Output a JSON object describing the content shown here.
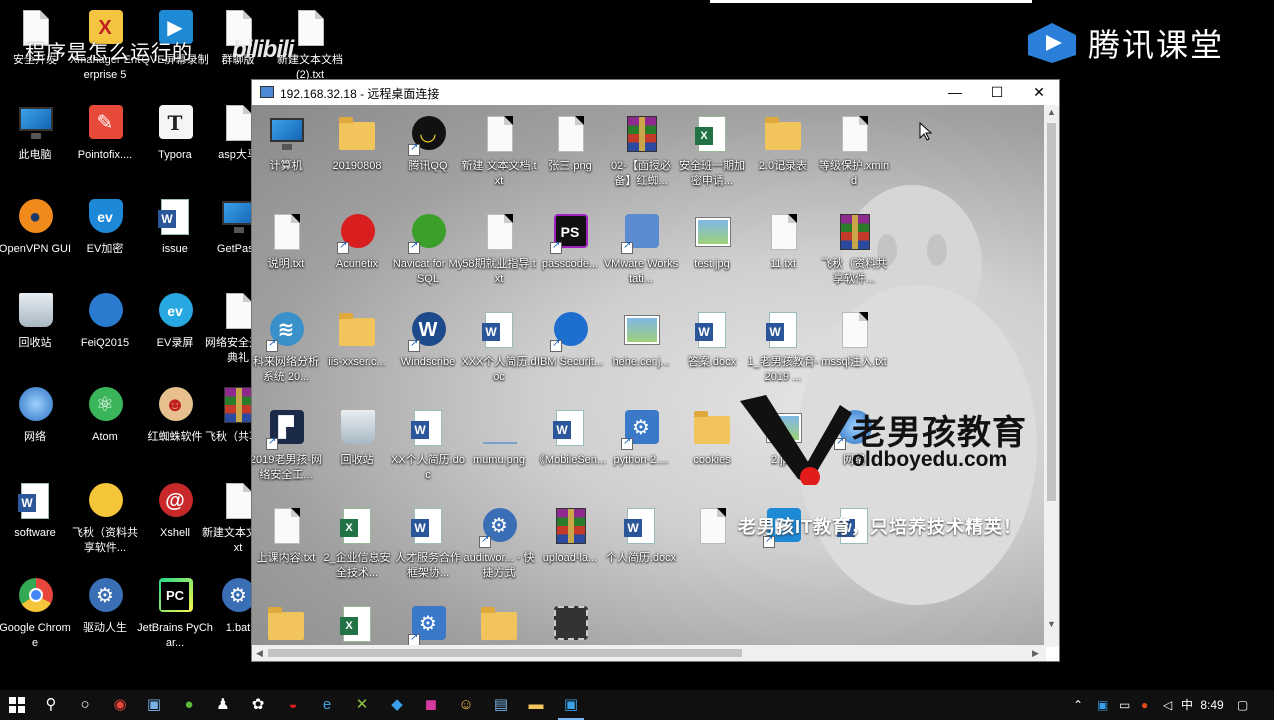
{
  "overlay": {
    "video_title": "程序是怎么运行的",
    "watermark": "bilibili",
    "brand": "腾讯课堂"
  },
  "desktop_icons": [
    {
      "label": "安全开发",
      "icon": "doc"
    },
    {
      "label": "Xmanager Enterprise 5",
      "icon": "x-logo"
    },
    {
      "label": "QVE屏幕录制",
      "icon": "play"
    },
    {
      "label": "群聊版",
      "icon": "doc"
    },
    {
      "label": "新建文本文档 (2).txt",
      "icon": "doc"
    },
    {
      "label": "此电脑",
      "icon": "monitor"
    },
    {
      "label": "Pointofix....",
      "icon": "pointofix"
    },
    {
      "label": "Typora",
      "icon": "typora"
    },
    {
      "label": "asp大马",
      "icon": "doc"
    },
    {
      "label": "OpenVPN GUI",
      "icon": "openvpn"
    },
    {
      "label": "EV加密",
      "icon": "ev"
    },
    {
      "label": "issue",
      "icon": "word-doc"
    },
    {
      "label": "GetPass",
      "icon": "monitor"
    },
    {
      "label": "回收站",
      "icon": "recycle"
    },
    {
      "label": "FeiQ2015",
      "icon": "feiq"
    },
    {
      "label": "EV录屏",
      "icon": "ev-rec"
    },
    {
      "label": "网络安全开班典礼",
      "icon": "doc"
    },
    {
      "label": "网络",
      "icon": "network"
    },
    {
      "label": "Atom",
      "icon": "atom"
    },
    {
      "label": "红蜘蛛软件",
      "icon": "redspider"
    },
    {
      "label": "飞秋（共享软",
      "icon": "rar"
    },
    {
      "label": "software",
      "icon": "word-doc"
    },
    {
      "label": "飞秋（资料共享软件...",
      "icon": "feiq-weather"
    },
    {
      "label": "Xshell",
      "icon": "xshell"
    },
    {
      "label": "新建文本文档.txt",
      "icon": "doc"
    },
    {
      "label": "Google Chrome",
      "icon": "chrome"
    },
    {
      "label": "驱动人生",
      "icon": "gear"
    },
    {
      "label": "JetBrains PyChar...",
      "icon": "pycharm"
    },
    {
      "label": "1.bat",
      "icon": "gear"
    }
  ],
  "remote_window": {
    "title": "192.168.32.18 - 远程桌面连接",
    "minimize": "—",
    "maximize": "☐",
    "close": "✕",
    "icons": [
      {
        "label": "计算机",
        "icon": "monitor"
      },
      {
        "label": "20190808",
        "icon": "folder"
      },
      {
        "label": "腾讯QQ",
        "icon": "qq"
      },
      {
        "label": "新建 文本文档.txt",
        "icon": "doc"
      },
      {
        "label": "张三.png",
        "icon": "doc"
      },
      {
        "label": "02-【面授必备】红蜘...",
        "icon": "rar"
      },
      {
        "label": "安全班一期加密申请...",
        "icon": "excel"
      },
      {
        "label": "2.0记录表",
        "icon": "folder"
      },
      {
        "label": "等级保护.xmind",
        "icon": "doc"
      },
      {
        "label": "说明.txt",
        "icon": "doc"
      },
      {
        "label": "Acunetix",
        "icon": "acunetix"
      },
      {
        "label": "Navicat for MySQL",
        "icon": "navicat"
      },
      {
        "label": "58期就业指导.txt",
        "icon": "doc"
      },
      {
        "label": "passcode...",
        "icon": "ps"
      },
      {
        "label": "VMware Workstati...",
        "icon": "vmware"
      },
      {
        "label": "test.jpg",
        "icon": "linux-pic"
      },
      {
        "label": "11.txt",
        "icon": "doc"
      },
      {
        "label": "飞秋（资料共享软件...",
        "icon": "rar"
      },
      {
        "label": "科来网络分析系统 20...",
        "icon": "colasoft"
      },
      {
        "label": "iis-xxser.c...",
        "icon": "folder"
      },
      {
        "label": "Windscribe",
        "icon": "windscribe"
      },
      {
        "label": "XXX个人简历.doc",
        "icon": "word"
      },
      {
        "label": "IBM Securit...",
        "icon": "ibm"
      },
      {
        "label": "hehe.cer.j...",
        "icon": "picture"
      },
      {
        "label": "答案.docx",
        "icon": "word"
      },
      {
        "label": "1_老男孩教育-2019 ...",
        "icon": "word"
      },
      {
        "label": "mssql注入.txt",
        "icon": "doc"
      },
      {
        "label": "2019老男孩-网络安全工...",
        "icon": "app-dark"
      },
      {
        "label": "回收站",
        "icon": "recycle"
      },
      {
        "label": "XX个人简历.doc",
        "icon": "word"
      },
      {
        "label": "mumu.png",
        "icon": "blank"
      },
      {
        "label": "《MobileSen...",
        "icon": "word"
      },
      {
        "label": "python-2....",
        "icon": "installer"
      },
      {
        "label": "cookies",
        "icon": "folder"
      },
      {
        "label": "2.jpg",
        "icon": "picture"
      },
      {
        "label": "网络",
        "icon": "globe"
      },
      {
        "label": "上课内容.txt",
        "icon": "doc"
      },
      {
        "label": "2_企业信息安全技术...",
        "icon": "excel"
      },
      {
        "label": "人才服务合作框架协...",
        "icon": "word"
      },
      {
        "label": "auditwor... - 快捷方式",
        "icon": "gear"
      },
      {
        "label": "upload-la...",
        "icon": "rar"
      },
      {
        "label": "个人简历.docx",
        "icon": "word"
      },
      {
        "label": "",
        "icon": "doc"
      },
      {
        "label": "",
        "icon": "play"
      },
      {
        "label": "",
        "icon": "word"
      },
      {
        "label": "",
        "icon": "folder"
      },
      {
        "label": "",
        "icon": "excel"
      },
      {
        "label": "",
        "icon": "installer"
      },
      {
        "label": "",
        "icon": "folder"
      },
      {
        "label": "",
        "icon": "film"
      }
    ],
    "watermark_cn": "老男孩教育",
    "watermark_en": "oldboyedu.com",
    "slogan": "老男孩IT教育，只培养技术精英！"
  },
  "taskbar": {
    "clock": "8:49",
    "apps": [
      "start",
      "search",
      "cortana",
      "chrome",
      "remote-desktop",
      "evernote",
      "qq",
      "settings",
      "acunetix",
      "edge",
      "xmind",
      "feiq",
      "rdp",
      "explorer",
      "rdp-active"
    ]
  },
  "colors": {
    "remote_bg": "#b8b8b8",
    "taskbar_bg": "#101010",
    "accent": "#2b579a"
  }
}
